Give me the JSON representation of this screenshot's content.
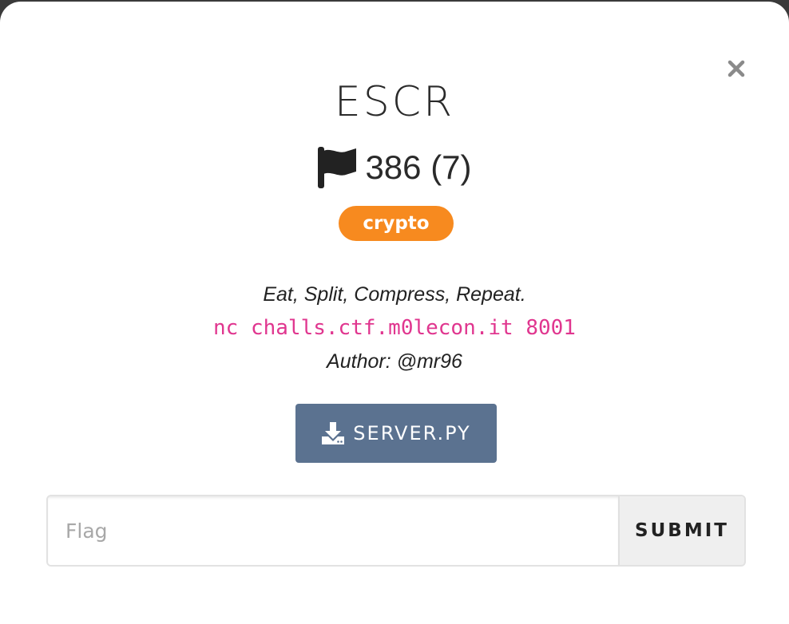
{
  "modal": {
    "title": "ESCR",
    "points_text": "386 (7)",
    "category_tag": "crypto",
    "description": "Eat, Split, Compress, Repeat.",
    "connection_command": "nc challs.ctf.m0lecon.it 8001",
    "author": "Author: @mr96",
    "close_icon": "close-icon",
    "flag_icon": "flag-icon",
    "download_icon": "download-icon",
    "download_label": "SERVER.PY",
    "flag_placeholder": "Flag",
    "flag_value": "",
    "submit_label": "SUBMIT"
  },
  "colors": {
    "tag_background": "#f78a1f",
    "command_text": "#e0368f",
    "download_button": "#5b7290",
    "submit_button": "#efefef"
  }
}
